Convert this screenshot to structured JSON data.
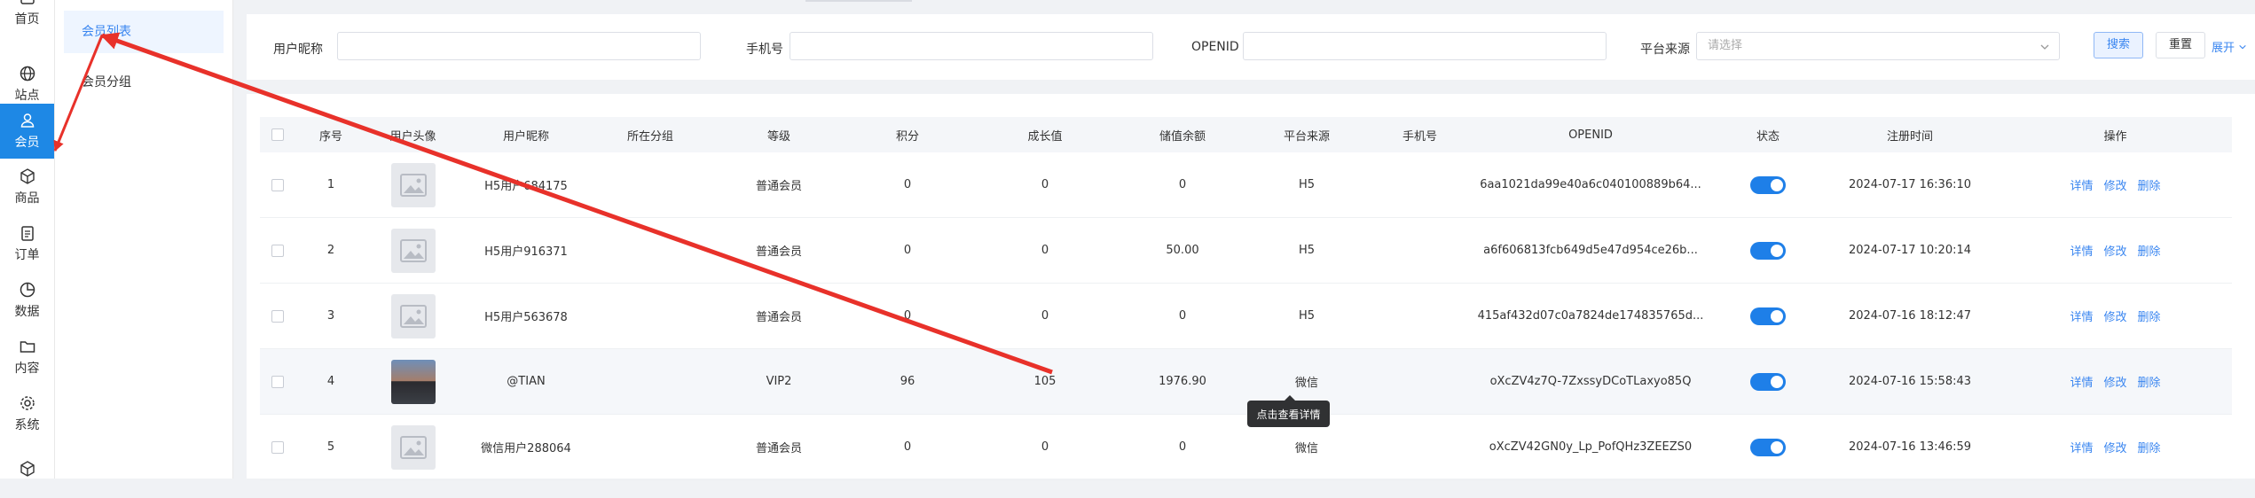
{
  "rail": [
    {
      "label": "首页",
      "icon": "chart-icon"
    },
    {
      "label": "站点",
      "icon": "globe-icon"
    },
    {
      "label": "会员",
      "icon": "user-icon",
      "active": true
    },
    {
      "label": "商品",
      "icon": "cube-icon"
    },
    {
      "label": "订单",
      "icon": "order-icon"
    },
    {
      "label": "数据",
      "icon": "pie-icon"
    },
    {
      "label": "内容",
      "icon": "folder-icon"
    },
    {
      "label": "系统",
      "icon": "gear-icon"
    },
    {
      "label": "",
      "icon": "box-icon"
    }
  ],
  "submenu": [
    {
      "label": "会员列表",
      "active": true
    },
    {
      "label": "会员分组"
    }
  ],
  "filters": {
    "nickname_label": "用户昵称",
    "phone_label": "手机号",
    "openid_label": "OPENID",
    "source_label": "平台来源",
    "source_placeholder": "请选择",
    "search_btn": "搜索",
    "reset_btn": "重置",
    "expand_label": "展开"
  },
  "table": {
    "headers": [
      "序号",
      "用户头像",
      "用户昵称",
      "所在分组",
      "等级",
      "积分",
      "成长值",
      "储值余额",
      "平台来源",
      "手机号",
      "OPENID",
      "状态",
      "注册时间",
      "操作"
    ],
    "rows": [
      {
        "no": "1",
        "nickname": "H5用户684175",
        "group": "",
        "level": "普通会员",
        "points": "0",
        "growth": "0",
        "balance": "0",
        "source": "H5",
        "phone": "",
        "openid": "6aa1021da99e40a6c040100889b64...",
        "time": "2024-07-17 16:36:10",
        "avatar": "placeholder"
      },
      {
        "no": "2",
        "nickname": "H5用户916371",
        "group": "",
        "level": "普通会员",
        "points": "0",
        "growth": "0",
        "balance": "50.00",
        "source": "H5",
        "phone": "",
        "openid": "a6f606813fcb649d5e47d954ce26b...",
        "time": "2024-07-17 10:20:14",
        "avatar": "placeholder"
      },
      {
        "no": "3",
        "nickname": "H5用户563678",
        "group": "",
        "level": "普通会员",
        "points": "0",
        "growth": "0",
        "balance": "0",
        "source": "H5",
        "phone": "",
        "openid": "415af432d07c0a7824de174835765d...",
        "time": "2024-07-16 18:12:47",
        "avatar": "placeholder"
      },
      {
        "no": "4",
        "nickname": "@TIAN",
        "group": "",
        "level": "VIP2",
        "points": "96",
        "growth": "105",
        "balance": "1976.90",
        "source": "微信",
        "phone": "",
        "openid": "oXcZV4z7Q-7ZxssyDCoTLaxyo85Q",
        "time": "2024-07-16 15:58:43",
        "avatar": "photo"
      },
      {
        "no": "5",
        "nickname": "微信用户288064",
        "group": "",
        "level": "普通会员",
        "points": "0",
        "growth": "0",
        "balance": "0",
        "source": "微信",
        "phone": "",
        "openid": "oXcZV42GN0y_Lp_PofQHz3ZEEZS0",
        "time": "2024-07-16 13:46:59",
        "avatar": "placeholder"
      }
    ],
    "ops": [
      "详情",
      "修改",
      "删除"
    ]
  },
  "tooltip": "点击查看详情",
  "colors": {
    "accent": "#1e88e5",
    "link": "#3a86f0",
    "annotation": "#e8312a"
  }
}
